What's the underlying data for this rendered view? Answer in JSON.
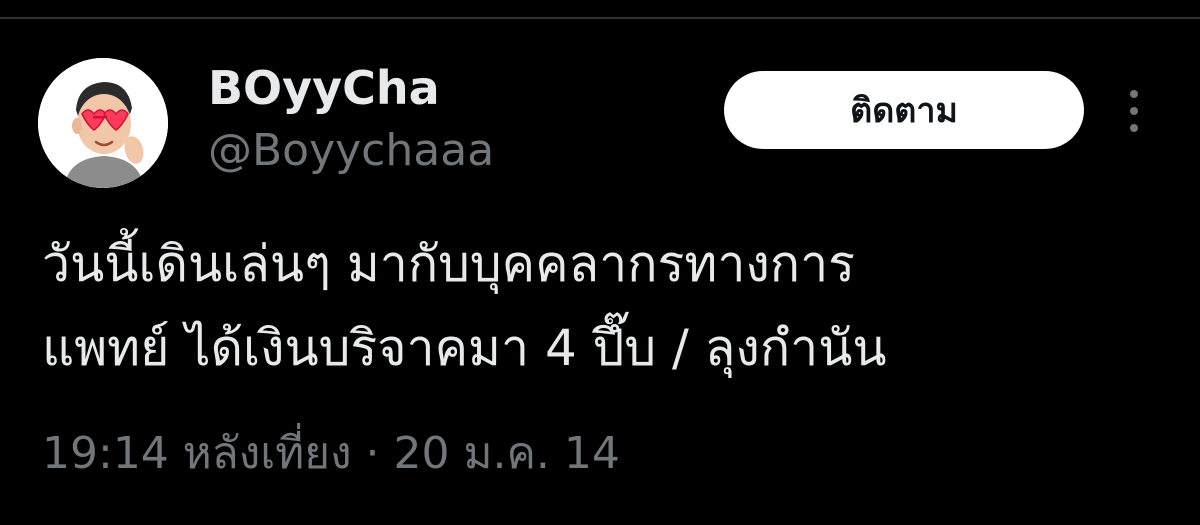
{
  "tweet": {
    "author": {
      "display_name": "BOyyCha",
      "handle": "@Boyychaaa"
    },
    "follow_label": "ติดตาม",
    "text_lines": [
      "วันนี้เดินเล่นๆ มากับบุคคลากรทางการ",
      "แพทย์ ได้เงินบริจาคมา 4 ปึ๊บ / ลุงกำนัน"
    ],
    "timestamp": "19:14 หลังเที่ยง · 20 ม.ค. 14"
  },
  "colors": {
    "background": "#000000",
    "primary_text": "#e7e9ea",
    "secondary_text": "#71767b",
    "button_bg": "#ffffff"
  },
  "icons": {
    "avatar": "memoji-avatar",
    "more": "more-vertical-icon"
  }
}
